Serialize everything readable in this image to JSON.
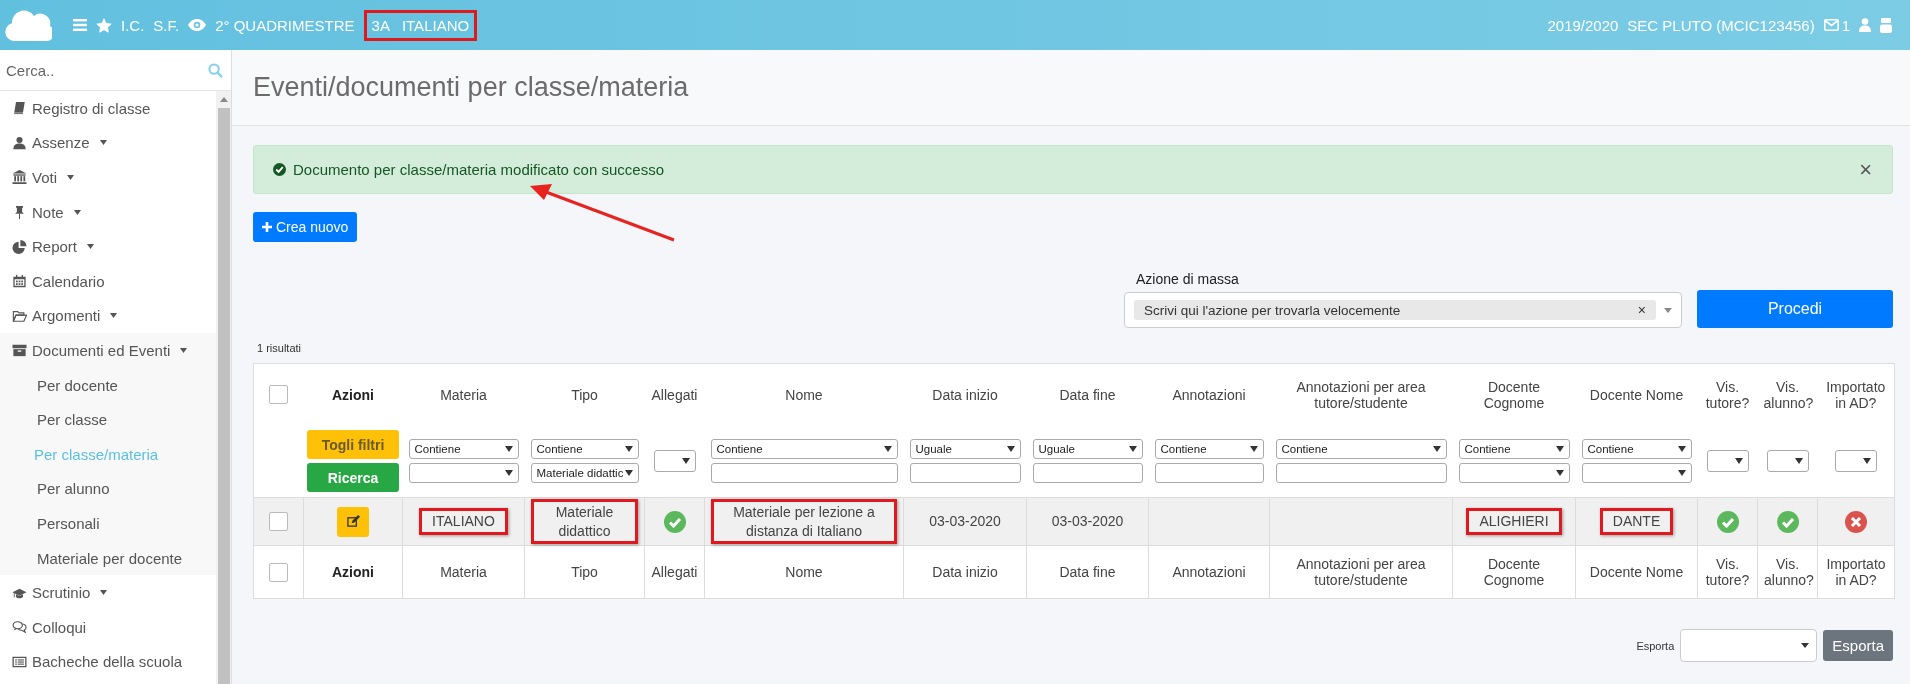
{
  "topbar": {
    "school": "I.C.",
    "user": "S.F.",
    "period": "2° QUADRIMESTRE",
    "class": "3A",
    "subject": "ITALIANO",
    "highlighted": true,
    "year": "2019/2020",
    "account": "SEC PLUTO (MCIC123456)",
    "unread": "1"
  },
  "sidebar": {
    "search": {
      "placeholder": "Cerca.."
    },
    "items": [
      {
        "label": "Registro di classe",
        "caret": false
      },
      {
        "label": "Assenze",
        "caret": true
      },
      {
        "label": "Voti",
        "caret": true
      },
      {
        "label": "Note",
        "caret": true
      },
      {
        "label": "Report",
        "caret": true
      },
      {
        "label": "Calendario",
        "caret": false
      },
      {
        "label": "Argomenti",
        "caret": true
      },
      {
        "label": "Documenti ed Eventi",
        "caret": true,
        "children": [
          {
            "label": "Per docente",
            "selected": false
          },
          {
            "label": "Per classe",
            "selected": false
          },
          {
            "label": "Per classe/materia",
            "selected": true
          },
          {
            "label": "Per alunno",
            "selected": false
          },
          {
            "label": "Personali",
            "selected": false
          },
          {
            "label": "Materiale per docente",
            "selected": false
          }
        ]
      },
      {
        "label": "Scrutinio",
        "caret": true
      },
      {
        "label": "Colloqui",
        "caret": false
      },
      {
        "label": "Bacheche della scuola",
        "caret": false
      }
    ]
  },
  "page_title": "Eventi/documenti per classe/materia",
  "alert": {
    "message": "Documento per classe/materia modificato con successo",
    "close": "×"
  },
  "create_button": "Crea nuovo",
  "mass_action": {
    "label": "Azione di massa",
    "value": "Scrivi qui l'azione per trovarla velocemente",
    "clear": "×",
    "button": "Procedi"
  },
  "result_count": "1 risultati",
  "table": {
    "header_checkbox": {
      "checked": false
    },
    "footer_checkbox": {
      "checked": false
    },
    "columns": [
      {
        "header": "Azioni",
        "kind": "actions",
        "filters": [
          {
            "kind": "button",
            "label": "Togli filtri"
          },
          {
            "kind": "button",
            "label": "Ricerca"
          }
        ]
      },
      {
        "header": "Materia",
        "kind": "text",
        "filters": [
          {
            "kind": "select",
            "value": "Contiene"
          },
          {
            "kind": "select"
          }
        ]
      },
      {
        "header": "Tipo",
        "kind": "text",
        "filters": [
          {
            "kind": "select",
            "value": "Contiene"
          },
          {
            "kind": "select",
            "value": "Materiale didattic"
          }
        ]
      },
      {
        "header": "Allegati",
        "kind": "text",
        "filters": [
          {
            "kind": "small-select"
          }
        ]
      },
      {
        "header": "Nome",
        "kind": "text",
        "filters": [
          {
            "kind": "select",
            "value": "Contiene"
          },
          {
            "kind": "input"
          }
        ]
      },
      {
        "header": "Data inizio",
        "kind": "text",
        "filters": [
          {
            "kind": "select",
            "value": "Uguale"
          },
          {
            "kind": "input"
          }
        ]
      },
      {
        "header": "Data fine",
        "kind": "text",
        "filters": [
          {
            "kind": "select",
            "value": "Uguale"
          },
          {
            "kind": "input"
          }
        ]
      },
      {
        "header": "Annotazioni",
        "kind": "text",
        "filters": [
          {
            "kind": "select",
            "value": "Contiene"
          },
          {
            "kind": "input"
          }
        ]
      },
      {
        "header": "Annotazioni per area tutore/studente",
        "kind": "text",
        "filters": [
          {
            "kind": "select",
            "value": "Contiene"
          },
          {
            "kind": "input"
          }
        ]
      },
      {
        "header": "Docente Cognome",
        "kind": "text",
        "filters": [
          {
            "kind": "select",
            "value": "Contiene"
          },
          {
            "kind": "select"
          }
        ]
      },
      {
        "header": "Docente Nome",
        "kind": "text",
        "filters": [
          {
            "kind": "select",
            "value": "Contiene"
          },
          {
            "kind": "select"
          }
        ]
      },
      {
        "header": "Vis. tutore?",
        "kind": "text",
        "filters": [
          {
            "kind": "small-select"
          }
        ]
      },
      {
        "header": "Vis. alunno?",
        "kind": "text",
        "filters": [
          {
            "kind": "small-select"
          }
        ]
      },
      {
        "header": "Importato in AD?",
        "kind": "text",
        "filters": [
          {
            "kind": "small-select"
          }
        ]
      }
    ],
    "rows": [
      {
        "checked": false,
        "cells": [
          {
            "kind": "edit"
          },
          {
            "kind": "text",
            "text": "ITALIANO",
            "highlighted": true
          },
          {
            "kind": "text",
            "text": "Materiale didattico",
            "highlighted": true
          },
          {
            "kind": "status",
            "ok": true
          },
          {
            "kind": "text",
            "text": "Materiale per lezione a distanza di Italiano",
            "highlighted": true
          },
          {
            "kind": "text",
            "text": "03-03-2020",
            "highlighted": false
          },
          {
            "kind": "text",
            "text": "03-03-2020",
            "highlighted": false
          },
          {
            "kind": "empty"
          },
          {
            "kind": "empty"
          },
          {
            "kind": "text",
            "text": "ALIGHIERI",
            "highlighted": true
          },
          {
            "kind": "text",
            "text": "DANTE",
            "highlighted": true
          },
          {
            "kind": "status",
            "ok": true
          },
          {
            "kind": "status",
            "ok": true
          },
          {
            "kind": "status",
            "ok": false
          }
        ]
      }
    ],
    "footer": [
      "Azioni",
      "Materia",
      "Tipo",
      "Allegati",
      "Nome",
      "Data inizio",
      "Data fine",
      "Annotazioni",
      "Annotazioni per area tutore/studente",
      "Docente Cognome",
      "Docente Nome",
      "Vis. tutore?",
      "Vis. alunno?",
      "Importato in AD?"
    ]
  },
  "export": {
    "label": "Esporta",
    "button": "Esporta"
  }
}
